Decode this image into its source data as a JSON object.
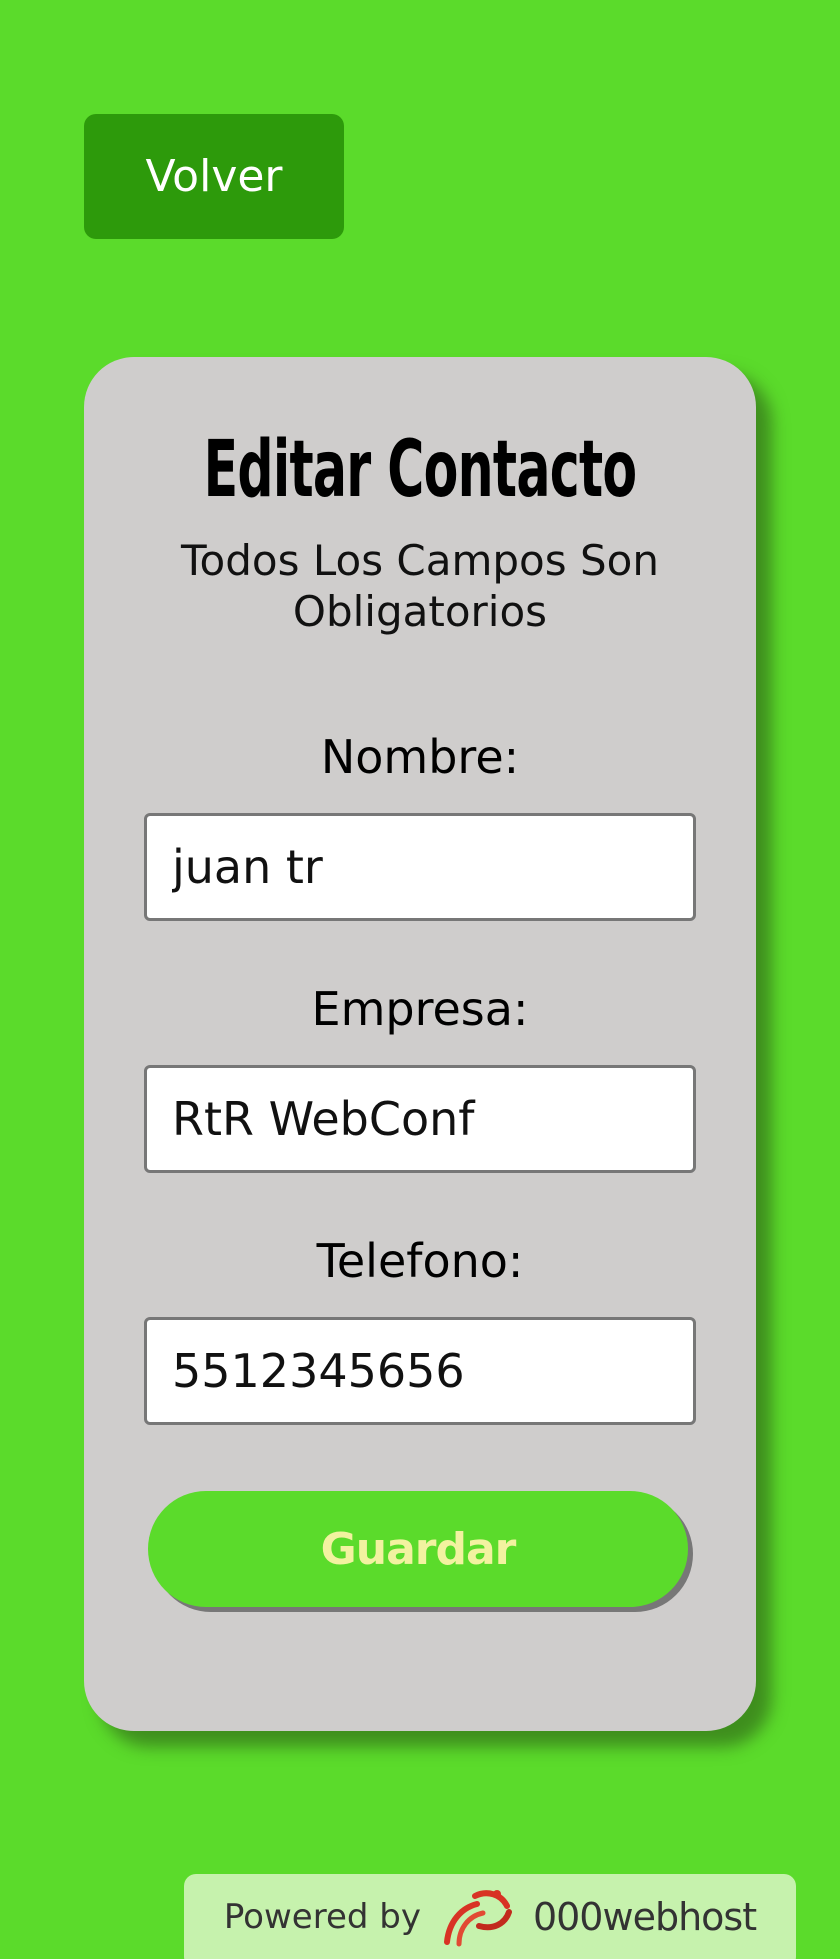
{
  "header": {
    "back_label": "Volver"
  },
  "form": {
    "title": "Editar Contacto",
    "subtitle": "Todos Los Campos Son Obligatorios",
    "fields": [
      {
        "label": "Nombre:",
        "value": "juan tr"
      },
      {
        "label": "Empresa:",
        "value": "RtR WebConf"
      },
      {
        "label": "Telefono:",
        "value": "5512345656"
      }
    ],
    "submit_label": "Guardar"
  },
  "footer": {
    "powered_by": "Powered by",
    "brand": "000webhost",
    "logo_icon": "000webhost-swirl-icon"
  },
  "colors": {
    "background": "#5bdb2b",
    "back_button": "#2d9a0b",
    "card": "#cfcdcc",
    "submit_text": "#f2f2a0"
  }
}
